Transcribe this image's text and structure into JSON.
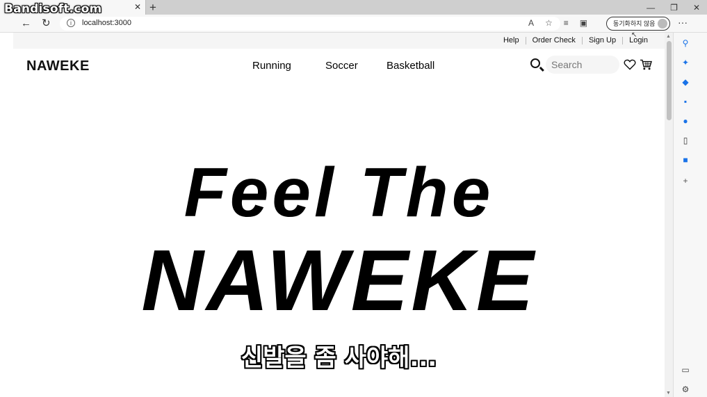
{
  "watermark": "Bandisoft.com",
  "browser": {
    "tab_close": "✕",
    "new_tab": "+",
    "url": "localhost:3000",
    "sync_label": "동기화하지 않음",
    "window_controls": [
      "—",
      "❐",
      "✕"
    ]
  },
  "site": {
    "utility_links": [
      "Help",
      "Order Check",
      "Sign Up",
      "Login"
    ],
    "logo": "NAWEKE",
    "nav": [
      "Running",
      "Soccer",
      "Basketball"
    ],
    "search_placeholder": "Search"
  },
  "hero": {
    "line1": "Feel The",
    "line2": "NAWEKE"
  },
  "caption": "신발을 좀 사야해..."
}
